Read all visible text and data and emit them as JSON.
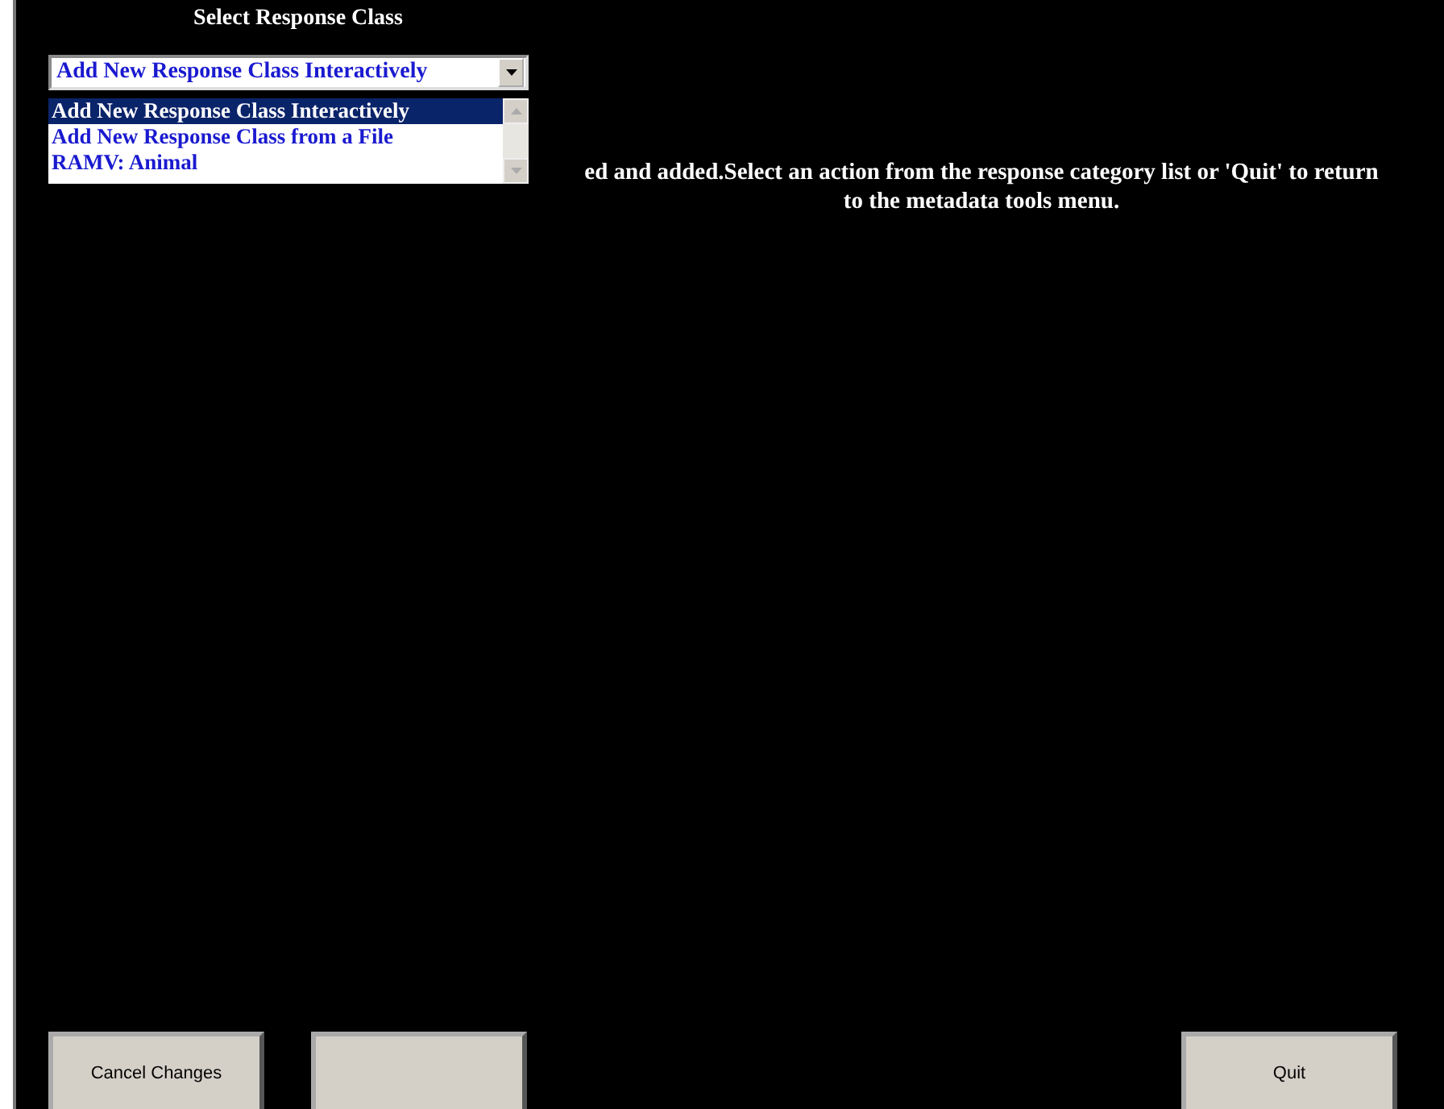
{
  "title": "Select Response Class",
  "dropdown": {
    "value": "Add New Response Class Interactively",
    "expanded": true,
    "options": [
      {
        "label": "Add New Response Class Interactively",
        "selected": true
      },
      {
        "label": "Add New Response Class from a File",
        "selected": false
      },
      {
        "label": "RAMV: Animal",
        "selected": false
      }
    ]
  },
  "message": [
    "ed and added.Select an action from the response category list or 'Quit' to return",
    "to the metadata tools menu."
  ],
  "buttons": [
    {
      "kind": "text",
      "label": "Cancel Changes"
    },
    {
      "kind": "blank"
    },
    {
      "kind": "text",
      "label": "Quit"
    }
  ]
}
